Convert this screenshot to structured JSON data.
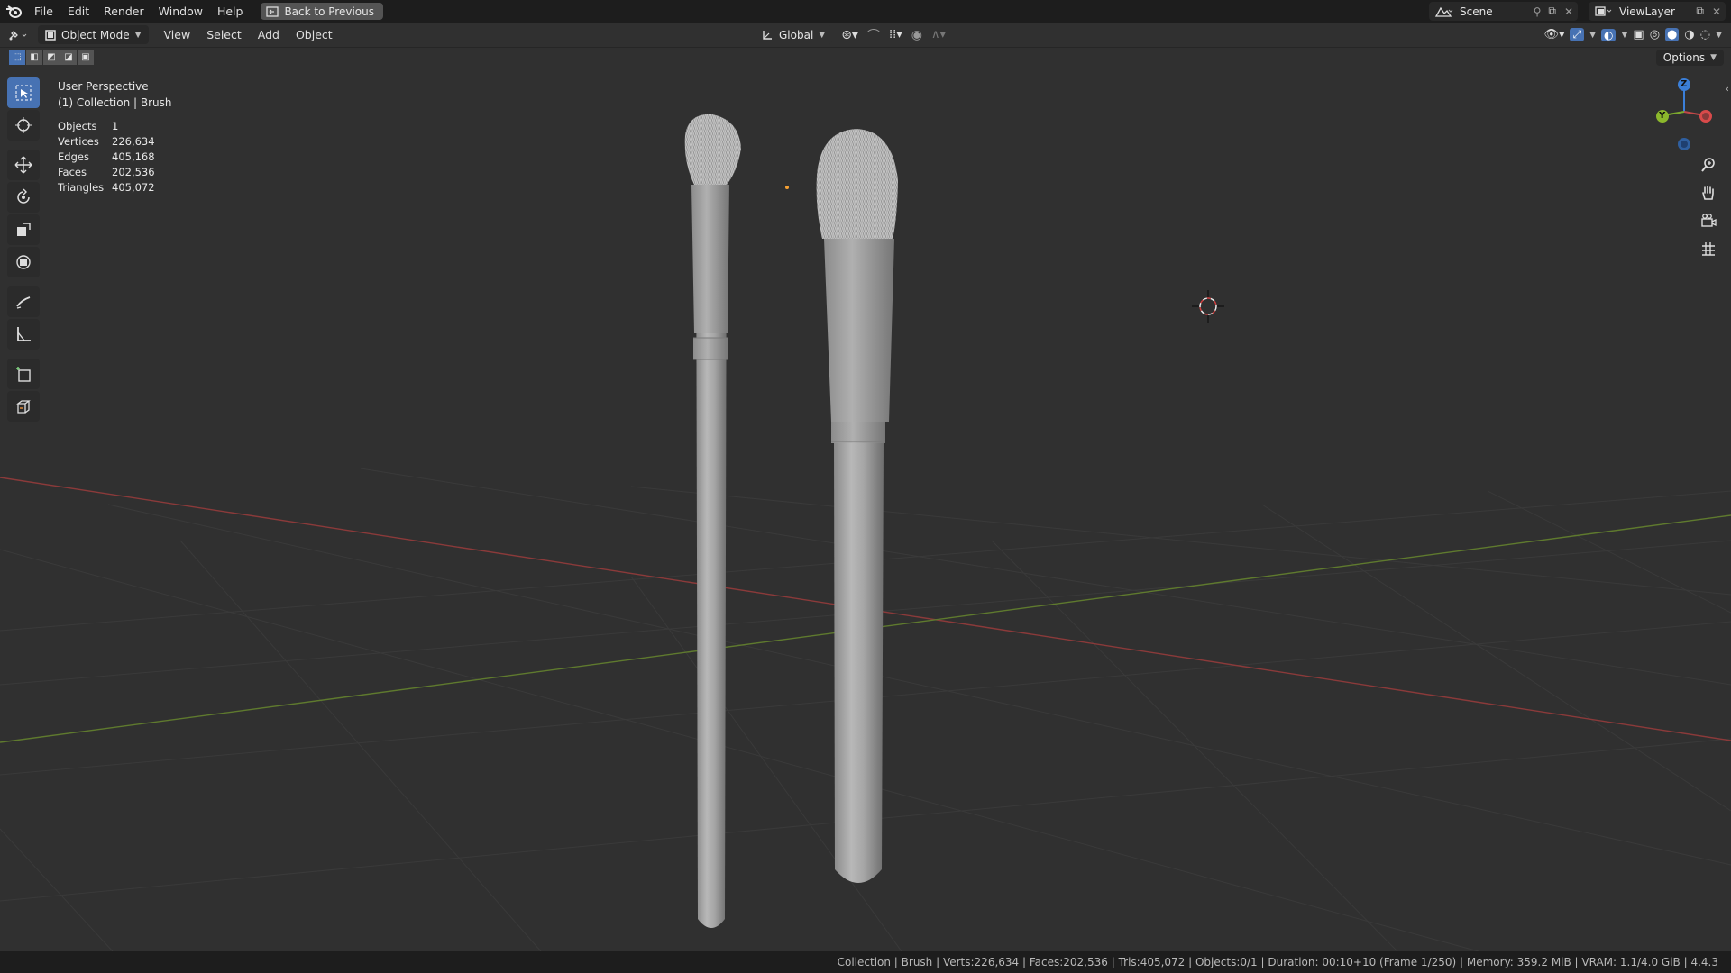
{
  "topbar": {
    "menus": [
      "File",
      "Edit",
      "Render",
      "Window",
      "Help"
    ],
    "back_button": "Back to Previous",
    "scene": "Scene",
    "view_layer": "ViewLayer"
  },
  "header": {
    "mode": "Object Mode",
    "menus": [
      "View",
      "Select",
      "Add",
      "Object"
    ],
    "transform_orientation": "Global",
    "options": "Options"
  },
  "viewport": {
    "perspective": "User Perspective",
    "collection": "(1) Collection | Brush",
    "stats": [
      {
        "label": "Objects",
        "value": "1"
      },
      {
        "label": "Vertices",
        "value": "226,634"
      },
      {
        "label": "Edges",
        "value": "405,168"
      },
      {
        "label": "Faces",
        "value": "202,536"
      },
      {
        "label": "Triangles",
        "value": "405,072"
      }
    ],
    "gizmo": {
      "z": "Z",
      "y": "Y"
    }
  },
  "status_bar": {
    "text": "Collection | Brush | Verts:226,634 | Faces:202,536 | Tris:405,072 | Objects:0/1 | Duration: 00:10+10 (Frame 1/250) | Memory: 359.2 MiB | VRAM: 1.1/4.0 GiB | 4.4.3"
  },
  "colors": {
    "background": "#303030",
    "header": "#1d1d1d",
    "accent": "#4772b3",
    "x_axis": "#8b3a3a",
    "y_axis": "#5f7a2e"
  }
}
